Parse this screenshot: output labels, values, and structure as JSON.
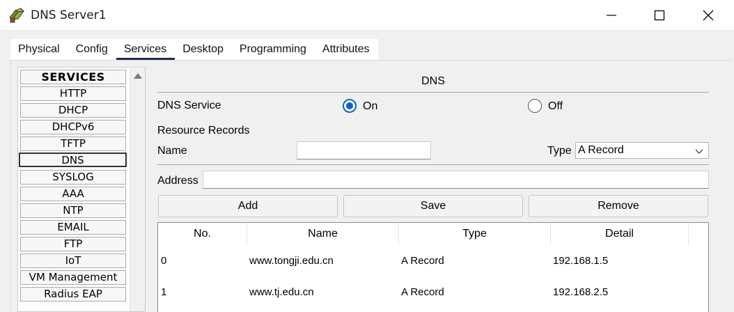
{
  "window": {
    "title": "DNS Server1"
  },
  "tabs": [
    {
      "label": "Physical"
    },
    {
      "label": "Config"
    },
    {
      "label": "Services"
    },
    {
      "label": "Desktop"
    },
    {
      "label": "Programming"
    },
    {
      "label": "Attributes"
    }
  ],
  "active_tab": "Services",
  "services": {
    "header": "SERVICES",
    "items": [
      "HTTP",
      "DHCP",
      "DHCPv6",
      "TFTP",
      "DNS",
      "SYSLOG",
      "AAA",
      "NTP",
      "EMAIL",
      "FTP",
      "IoT",
      "VM Management",
      "Radius EAP"
    ],
    "selected": "DNS"
  },
  "dns": {
    "title": "DNS",
    "service_label": "DNS Service",
    "on_label": "On",
    "off_label": "Off",
    "service_state": "On",
    "records_label": "Resource Records",
    "name_label": "Name",
    "name_value": "",
    "type_label": "Type",
    "type_value": "A Record",
    "address_label": "Address",
    "address_value": "",
    "add_label": "Add",
    "save_label": "Save",
    "remove_label": "Remove",
    "table": {
      "headers": [
        "No.",
        "Name",
        "Type",
        "Detail"
      ],
      "rows": [
        [
          "0",
          "www.tongji.edu.cn",
          "A Record",
          "192.168.1.5"
        ],
        [
          "1",
          "www.tj.edu.cn",
          "A Record",
          "192.168.2.5"
        ]
      ]
    }
  },
  "colors": {
    "accent": "#0a64c8",
    "tab_underline": "#1f2d4b",
    "close_hover": "#e81123"
  }
}
